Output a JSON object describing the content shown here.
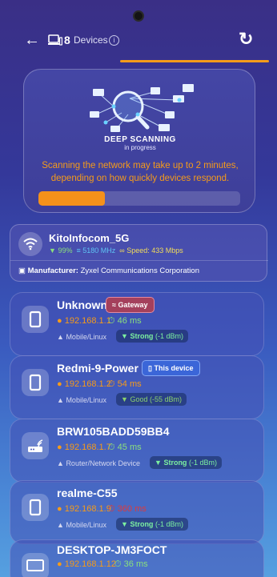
{
  "header": {
    "device_count": "8",
    "devices_label": "Devices",
    "info_glyph": "i"
  },
  "scan": {
    "heading": "DEEP SCANNING",
    "subheading": "in progress",
    "message": "Scanning the network may take up to 2 minutes, depending on how quickly devices respond.",
    "progress_fraction": 0.33,
    "accent_color": "#f59b1a"
  },
  "network": {
    "ssid": "KitoInfocom_5G",
    "signal": "99%",
    "frequency": "5180 MHz",
    "speed": "Speed: 433 Mbps",
    "manufacturer_label": "Manufacturer:",
    "manufacturer": "Zyxel Communications Corporation"
  },
  "devices": [
    {
      "name": "Unknown",
      "tag": "Gateway",
      "ip": "192.168.1.1",
      "ping": "46 ms",
      "type": "Mobile/Linux",
      "signal_word": "Strong",
      "signal_dbm": "(-1 dBm)"
    },
    {
      "name": "Redmi-9-Power",
      "tag": "This device",
      "ip": "192.168.1.2",
      "ping": "54 ms",
      "type": "Mobile/Linux",
      "signal_word": "Good",
      "signal_dbm": "(-55 dBm)"
    },
    {
      "name": "BRW105BADD59BB4",
      "tag": "",
      "ip": "192.168.1.7",
      "ping": "45 ms",
      "type": "Router/Network Device",
      "signal_word": "Strong",
      "signal_dbm": "(-1 dBm)"
    },
    {
      "name": "realme-C55",
      "tag": "",
      "ip": "192.168.1.9",
      "ping": "360 ms",
      "type": "Mobile/Linux",
      "signal_word": "Strong",
      "signal_dbm": "(-1 dBm)"
    },
    {
      "name": "DESKTOP-JM3FOCT",
      "tag": "",
      "ip": "192.168.1.12",
      "ping": "36 ms",
      "type": "",
      "signal_word": "",
      "signal_dbm": ""
    }
  ]
}
